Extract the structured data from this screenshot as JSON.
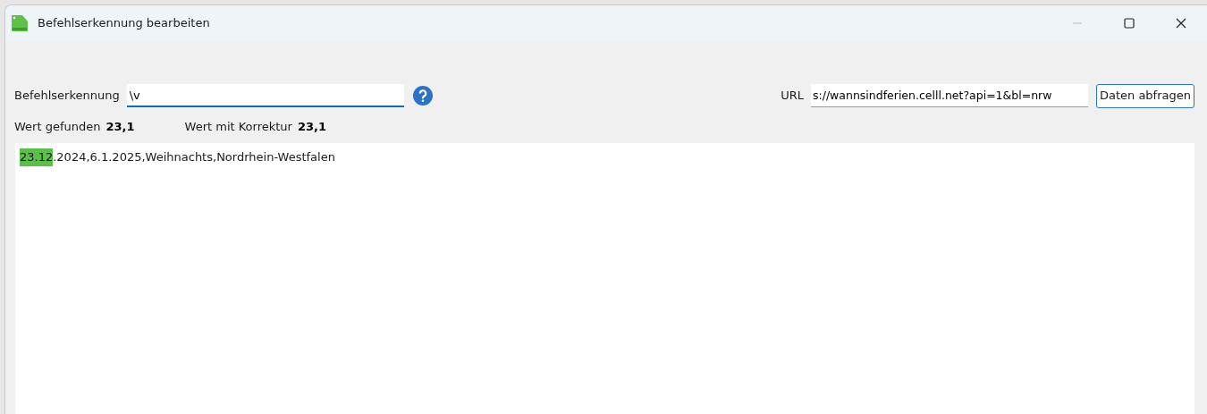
{
  "window": {
    "title": "Befehlserkennung bearbeiten"
  },
  "command": {
    "label": "Befehlserkennung",
    "value": "\\v",
    "focused": true
  },
  "url": {
    "label": "URL",
    "value": "s://wannsindferien.celll.net?api=1&bl=nrw"
  },
  "fetch_button": {
    "label": "Daten abfragen"
  },
  "values": [
    {
      "label": "Wert gefunden",
      "value": "23,1"
    },
    {
      "label": "Wert mit Korrektur",
      "value": "23,1"
    }
  ],
  "result": [
    {
      "text": "23.12",
      "highlighted": true
    },
    {
      "text": ".2024,6.1.2025,Weihnachts,Nordrhein-Westfalen",
      "highlighted": false
    }
  ]
}
